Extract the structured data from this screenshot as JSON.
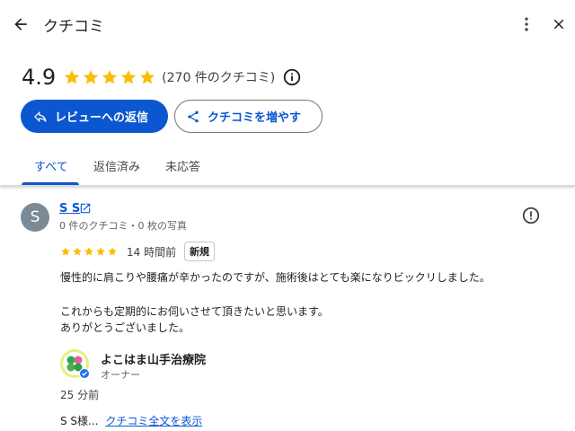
{
  "header": {
    "title": "クチコミ",
    "rating": "4.9",
    "star_count": 5,
    "star_color": "#fbbc04",
    "review_count": "(270 件のクチコミ)",
    "reply_button": "レビューへの返信",
    "more_reviews_button": "クチコミを増やす"
  },
  "tabs": [
    {
      "label": "すべて",
      "active": true
    },
    {
      "label": "返信済み",
      "active": false
    },
    {
      "label": "未応答",
      "active": false
    }
  ],
  "review": {
    "avatar_initial": "S",
    "author": "S S",
    "meta": "0 件のクチコミ・0 枚の写真",
    "rating": 5,
    "time": "14 時間前",
    "badge": "新規",
    "lines": [
      "慢性的に肩こりや腰痛が辛かったのですが、施術後はとても楽になりビックリしました。",
      "これからも定期的にお伺いさせて頂きたいと思います。",
      "ありがとうございました。"
    ],
    "owner_name": "よこはま山手治療院",
    "owner_role": "オーナー",
    "reply_time": "25 分前",
    "reply_preview": "S S様...",
    "reply_link": "クチコミ全文を表示"
  },
  "colors": {
    "accent": "#0b57d0",
    "star": "#fbbc04",
    "avatar": "#7a8a97"
  },
  "icons": [
    "back-arrow-icon",
    "more-vert-icon",
    "close-icon",
    "info-icon",
    "reply-icon",
    "share-icon",
    "open-in-new-icon",
    "report-icon",
    "verified-icon"
  ]
}
